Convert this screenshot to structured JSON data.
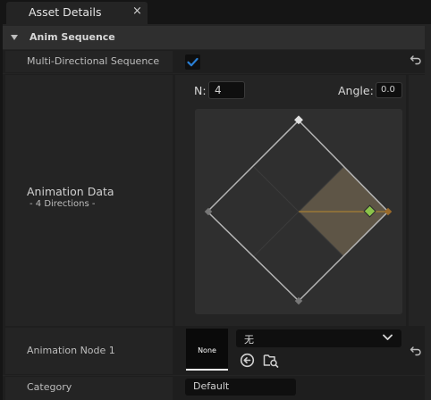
{
  "tab": {
    "title": "Asset Details",
    "close_glyph": "×"
  },
  "section": {
    "title": "Anim Sequence"
  },
  "rows": {
    "multi_directional": {
      "label": "Multi-Directional Sequence",
      "checked": true
    },
    "animation_data": {
      "label": "Animation Data",
      "sublabel": "- 4 Directions -",
      "n_label": "N:",
      "n_value": "4",
      "angle_label": "Angle:",
      "angle_value": "0.0"
    },
    "animation_node": {
      "label": "Animation Node 1",
      "thumbnail_label": "None",
      "selected_asset": "无"
    },
    "category": {
      "label": "Category",
      "value": "Default"
    }
  },
  "colors": {
    "accent_blue": "#2a7fd4",
    "sector_fill": "#5e5546",
    "selected_direction": "#8bc34a",
    "direction_line": "#b8892e"
  }
}
